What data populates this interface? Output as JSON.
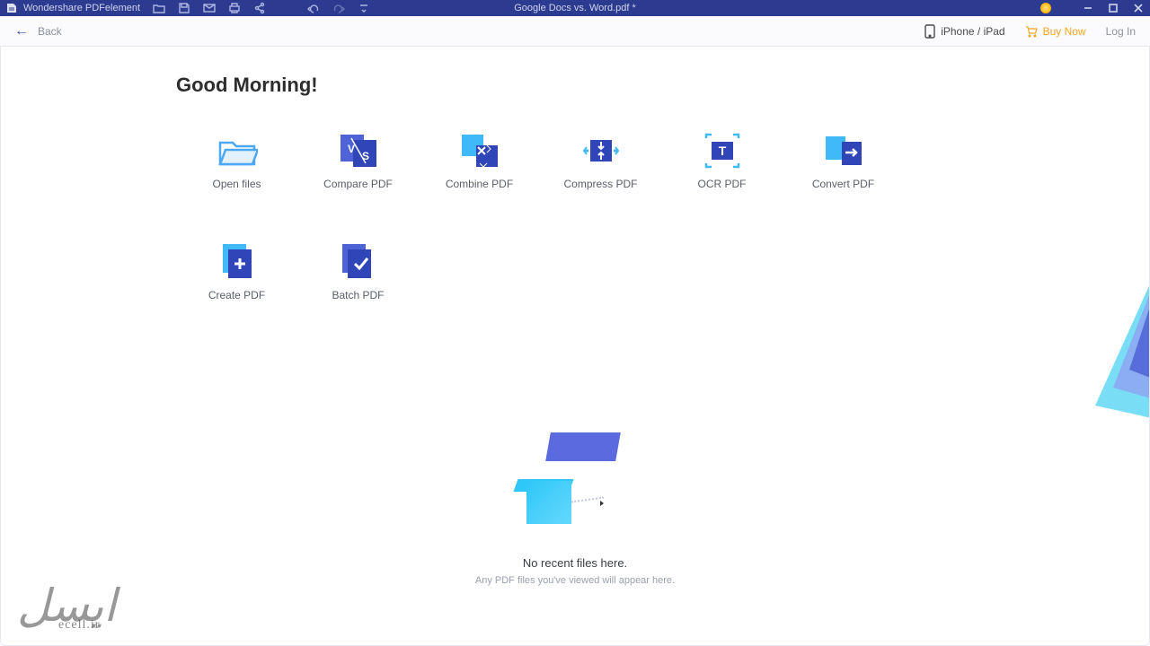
{
  "titlebar": {
    "app_name": "Wondershare PDFelement",
    "document_title": "Google Docs vs. Word.pdf *"
  },
  "toolbar": {
    "back_label": "Back",
    "iphone_label": "iPhone / iPad",
    "buy_now_label": "Buy Now",
    "login_label": "Log In"
  },
  "main": {
    "greeting": "Good Morning!",
    "tiles": [
      {
        "label": "Open files"
      },
      {
        "label": "Compare PDF"
      },
      {
        "label": "Combine PDF"
      },
      {
        "label": "Compress PDF"
      },
      {
        "label": "OCR PDF"
      },
      {
        "label": "Convert PDF"
      },
      {
        "label": "Create PDF"
      },
      {
        "label": "Batch PDF"
      }
    ],
    "empty": {
      "title": "No recent files here.",
      "subtitle": "Any PDF files you've viewed will appear here."
    }
  },
  "watermark": {
    "line1": "ایسل",
    "line2": "ecell.ir"
  },
  "colors": {
    "brand_dark": "#2c3b8f",
    "brand_mid": "#4d63d6",
    "brand_light": "#2ec7f7",
    "accent_orange": "#f5a623"
  }
}
